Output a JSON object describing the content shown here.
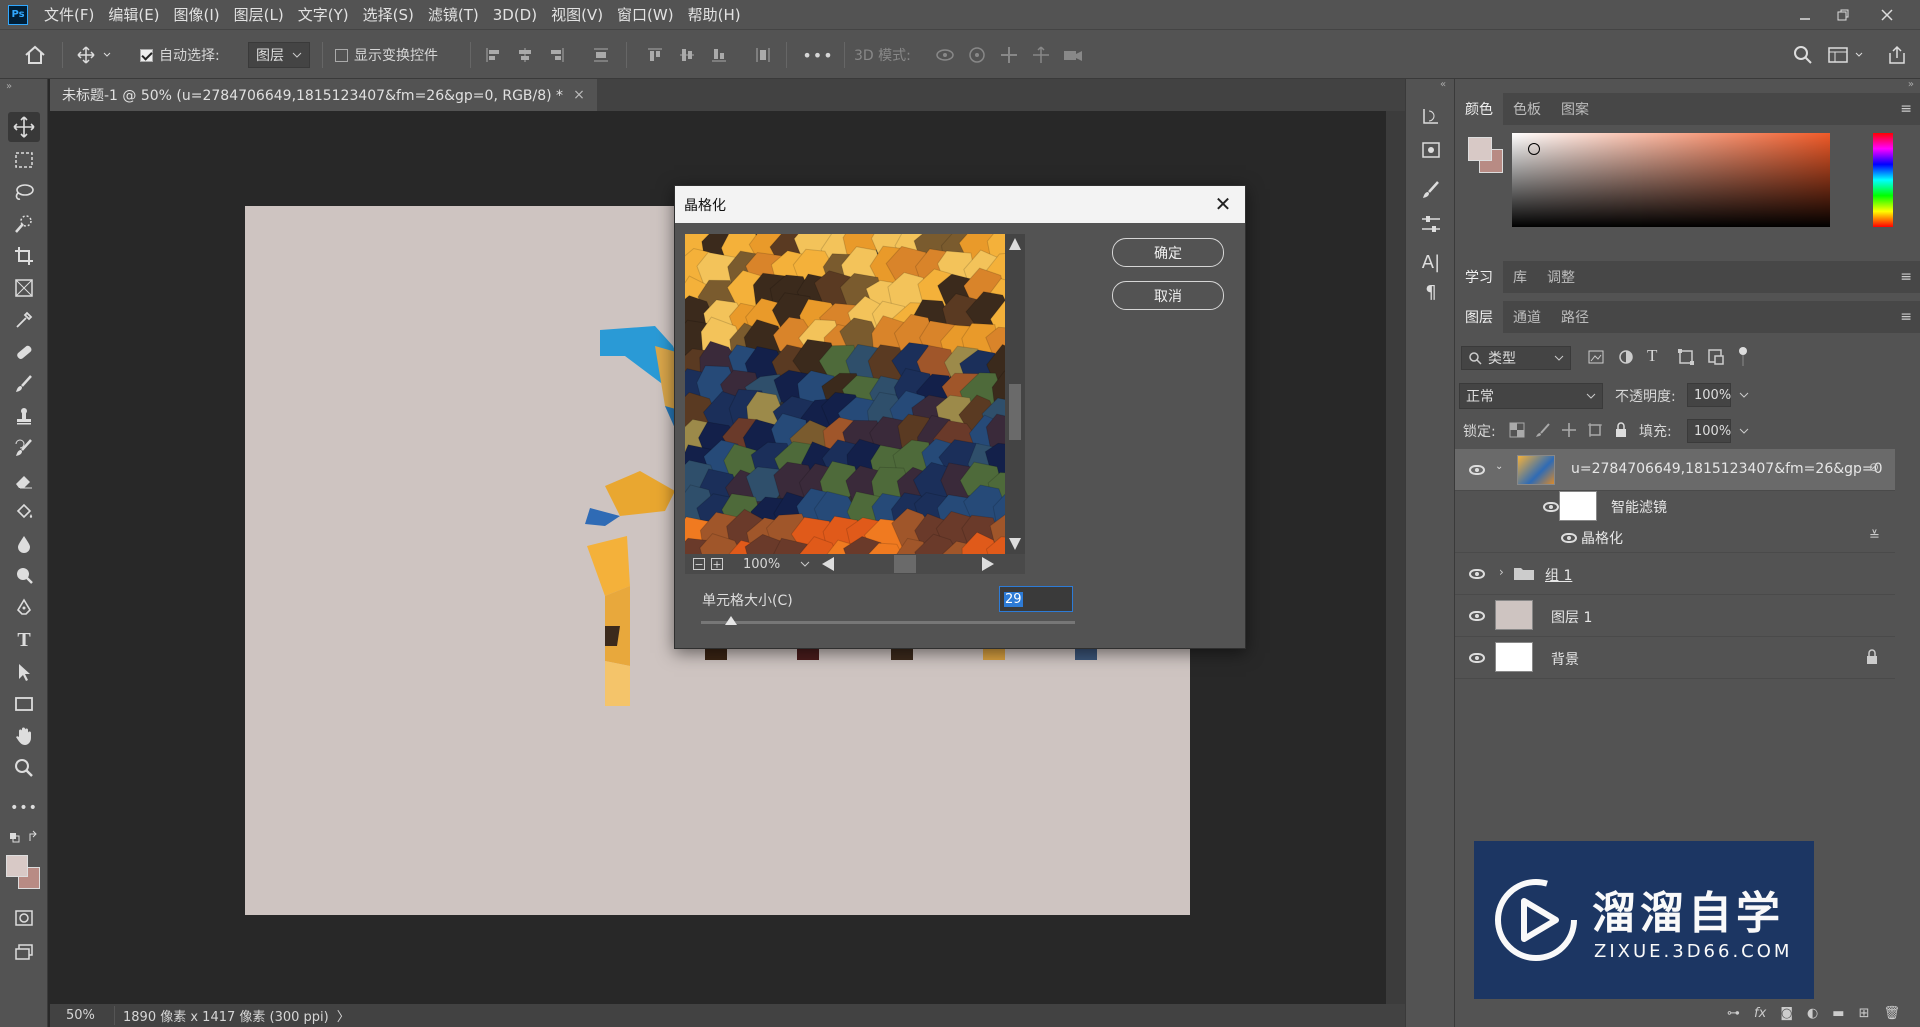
{
  "menubar": {
    "logo": "Ps",
    "items": [
      "文件(F)",
      "编辑(E)",
      "图像(I)",
      "图层(L)",
      "文字(Y)",
      "选择(S)",
      "滤镜(T)",
      "3D(D)",
      "视图(V)",
      "窗口(W)",
      "帮助(H)"
    ],
    "window_controls": [
      "minimize-icon",
      "restore-icon",
      "close-icon"
    ]
  },
  "options": {
    "auto_select_label": "自动选择:",
    "auto_select_checked": true,
    "auto_select_target": "图层",
    "show_transform_label": "显示变换控件",
    "show_transform_checked": false,
    "more_label": "•••",
    "mode3d_label": "3D 模式:"
  },
  "document": {
    "tab_title": "未标题-1 @ 50% (u=2784706649,1815123407&fm=26&gp=0, RGB/8) *",
    "canvas_color": "#cec4c1"
  },
  "status": {
    "zoom": "50%",
    "info": "1890 像素 x 1417 像素 (300 ppi)",
    "arrow": "〉"
  },
  "dialog": {
    "title": "晶格化",
    "ok_label": "确定",
    "cancel_label": "取消",
    "zoom_value": "100%",
    "cell_size_label": "单元格大小(C)",
    "cell_size_value": "29",
    "cell_size_slider": 0.08
  },
  "panels": {
    "color_tabs": [
      "颜色",
      "色板",
      "图案"
    ],
    "learn_tabs": [
      "学习",
      "库",
      "调整"
    ],
    "layers_tabs": [
      "图层",
      "通道",
      "路径"
    ],
    "filter_kind": "类型",
    "blend_mode": "正常",
    "opacity_label": "不透明度:",
    "opacity_value": "100%",
    "lock_label": "锁定:",
    "fill_label": "填充:",
    "fill_value": "100%",
    "foreground_color": "#d8c9c6",
    "background_color": "#b88b84",
    "layers": [
      {
        "name": "u=2784706649,1815123407&fm=26&gp=0",
        "type": "smart-object"
      },
      {
        "name": "智能滤镜",
        "type": "smart-filter-mask"
      },
      {
        "name": "晶格化",
        "type": "filter"
      },
      {
        "name": "组 1",
        "type": "group"
      },
      {
        "name": "图层 1",
        "type": "layer"
      },
      {
        "name": "背景",
        "type": "background",
        "locked": true
      }
    ]
  },
  "watermark": {
    "brand": "溜溜自学",
    "url": "ZIXUE.3D66.COM"
  }
}
